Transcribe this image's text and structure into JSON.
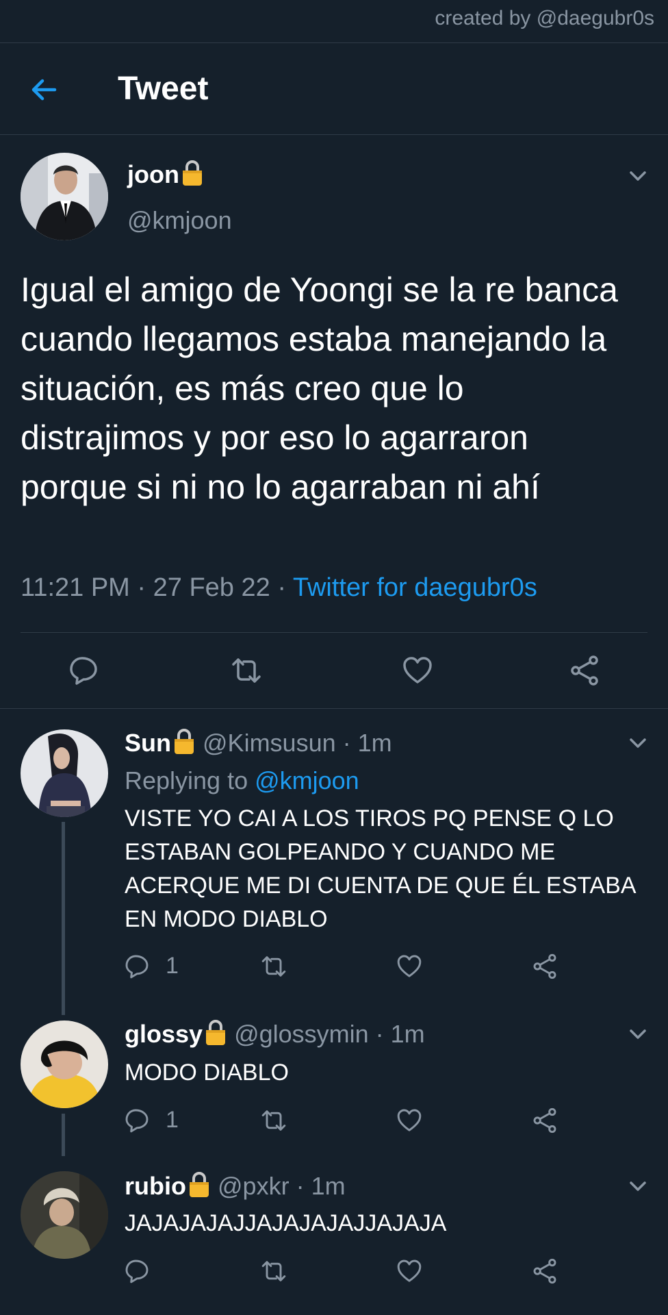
{
  "watermark": "created by @daegubr0s",
  "header": {
    "title": "Tweet"
  },
  "main_tweet": {
    "name": "joon",
    "handle": "@kmjoon",
    "text": "Igual el amigo de Yoongi se la re banca cuando llegamos estaba manejando la situación, es más creo que lo distrajimos y por eso lo agarraron porque si ni no lo agarraban ni ahí",
    "time": "11:21 PM",
    "date": "27 Feb 22",
    "separator": " · ",
    "source": "Twitter for daegubr0s"
  },
  "replies": [
    {
      "name": "Sun",
      "handle": "@Kimsusun",
      "time": "· 1m",
      "replying_label": "Replying to ",
      "replying_to": "@kmjoon",
      "text": "VISTE YO CAI A LOS TIROS PQ PENSE Q LO ESTABAN GOLPEANDO Y CUANDO ME ACERQUE ME DI CUENTA DE QUE ÉL ESTABA EN MODO DIABLO",
      "reply_count": "1"
    },
    {
      "name": "glossy",
      "handle": "@glossymin",
      "time": "· 1m",
      "text": "MODO DIABLO",
      "reply_count": "1"
    },
    {
      "name": "rubio",
      "handle": "@pxkr",
      "time": "· 1m",
      "text": "JAJAJAJAJJAJAJAJAJJAJAJA",
      "reply_count": ""
    }
  ],
  "icons": {
    "back": "arrow-left-icon",
    "lock": "lock-icon",
    "chevron": "chevron-down-icon",
    "reply": "reply-icon",
    "retweet": "retweet-icon",
    "like": "heart-icon",
    "share": "share-icon"
  },
  "colors": {
    "background": "#15202b",
    "accent": "#1d9bf0",
    "muted": "#8a96a3",
    "divider": "#2f3b47",
    "lock": "#f5b82e"
  }
}
